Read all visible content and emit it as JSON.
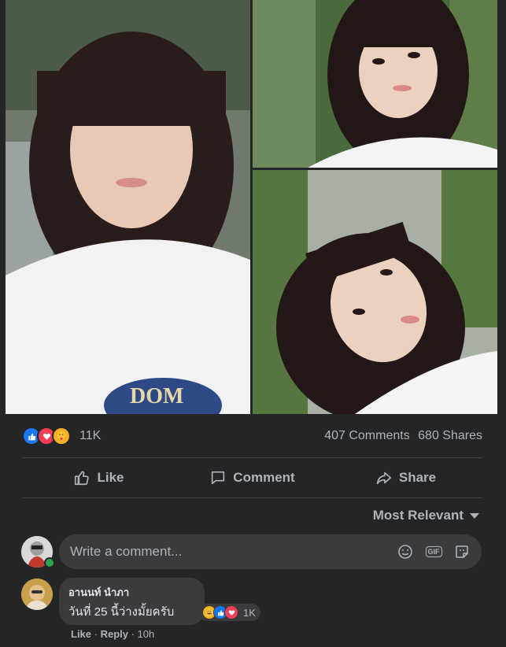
{
  "post": {
    "photos": [
      {
        "alt": "photo-1"
      },
      {
        "alt": "photo-2"
      },
      {
        "alt": "photo-3"
      }
    ],
    "reactions": {
      "types": [
        "like",
        "love",
        "care"
      ],
      "count": "11K"
    },
    "comments_count": "407 Comments",
    "shares_count": "680 Shares",
    "actions": {
      "like": "Like",
      "comment": "Comment",
      "share": "Share"
    },
    "sort_label": "Most Relevant",
    "composer": {
      "placeholder": "Write a comment..."
    },
    "comment": {
      "author": "อานนท์ นำภา",
      "text": "วันที่ 25 นี้ว่างมั้ยครับ",
      "reaction_count": "1K",
      "like_label": "Like",
      "reply_label": "Reply",
      "time": "10h"
    }
  },
  "colors": {
    "like_blue": "#1877f2",
    "love_red": "#f33e58",
    "care_yellow": "#f7b125",
    "online_green": "#31a24c",
    "bg": "#242526",
    "field": "#3a3b3c"
  }
}
